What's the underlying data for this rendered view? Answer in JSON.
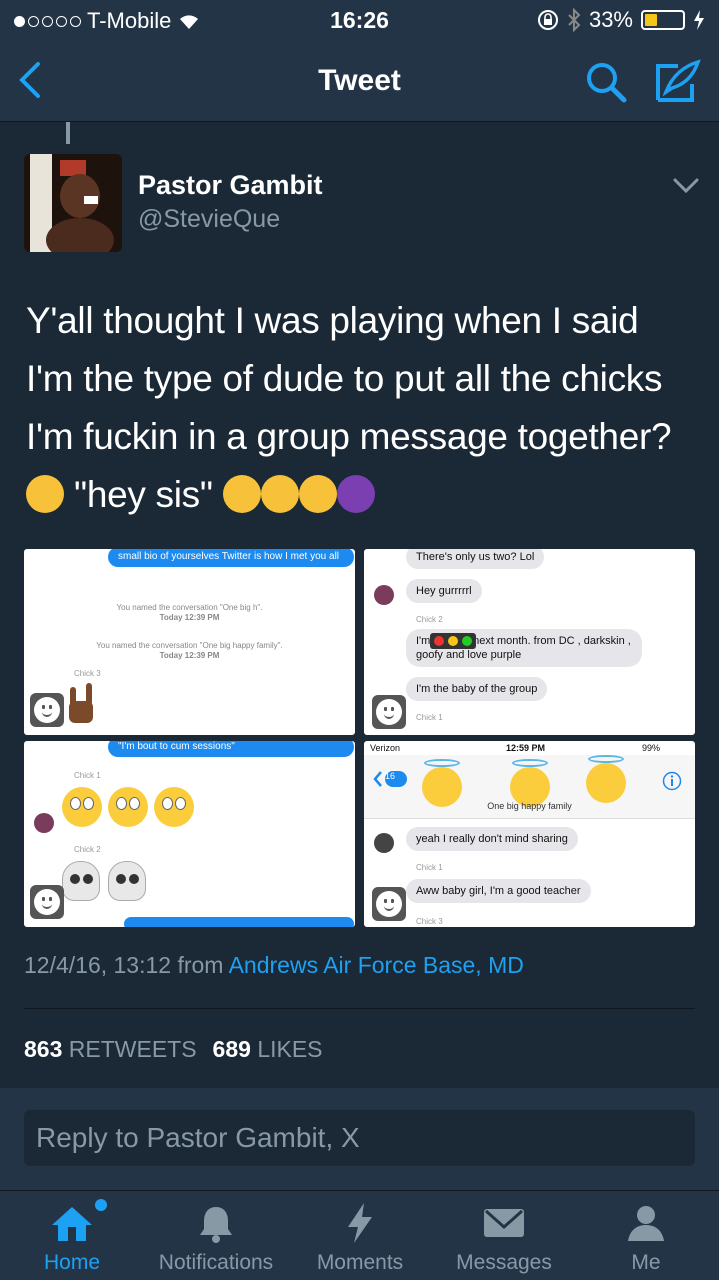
{
  "status_bar": {
    "carrier": "T-Mobile",
    "time": "16:26",
    "battery": "33%",
    "battery_level": 0.33
  },
  "nav": {
    "title": "Tweet"
  },
  "tweet": {
    "author_name": "Pastor Gambit",
    "author_handle": "@StevieQue",
    "text_line1": "Y'all thought I was playing when I said",
    "text_line2": "I'm the type of dude to put all the chicks",
    "text_line3": "I'm fuckin in a group message together?",
    "text_line4": "\"hey sis\"",
    "timestamp": "12/4/16, 13:12 from",
    "location": "Andrews Air Force Base, MD",
    "retweets_count": "863",
    "retweets_label": "RETWEETS",
    "likes_count": "689",
    "likes_label": "LIKES"
  },
  "media": {
    "m1": {
      "bubble": "small bio of yourselves Twitter is how I met you all",
      "sys1": "You named the conversation \"One big h\".",
      "sys1_time": "Today 12:39 PM",
      "sys2": "You named the conversation \"One big happy family\".",
      "sys2_time": "Today 12:39 PM",
      "sender": "Chick 3"
    },
    "m2": {
      "top": "There's only us two? Lol",
      "hey": "Hey gurrrrrl",
      "chick2": "Chick 2",
      "intro": "I'm        , 19, 20 next month. from DC , darkskin , goofy and love purple",
      "baby": "I'm the baby of the group",
      "chick1": "Chick 1"
    },
    "m3": {
      "bubble": "\"I'm bout to cum sessions\"",
      "chick1": "Chick 1",
      "chick2": "Chick 2"
    },
    "m4": {
      "carrier": "Verizon",
      "time": "12:59 PM",
      "battery": "99%",
      "back_count": "16",
      "group_name": "One big happy family",
      "msg1": "yeah I really don't mind sharing",
      "chick1": "Chick 1",
      "msg2": "Aww baby girl, I'm a good teacher",
      "chick3": "Chick 3"
    }
  },
  "reply": {
    "placeholder": "Reply to Pastor Gambit, X"
  },
  "tabs": [
    {
      "label": "Home",
      "icon": "home-icon",
      "active": true
    },
    {
      "label": "Notifications",
      "icon": "bell-icon"
    },
    {
      "label": "Moments",
      "icon": "lightning-icon"
    },
    {
      "label": "Messages",
      "icon": "envelope-icon"
    },
    {
      "label": "Me",
      "icon": "person-icon"
    }
  ],
  "colors": {
    "background": "#1b2836",
    "bar": "#243447",
    "accent": "#1da1f2",
    "muted": "#8899a6"
  }
}
